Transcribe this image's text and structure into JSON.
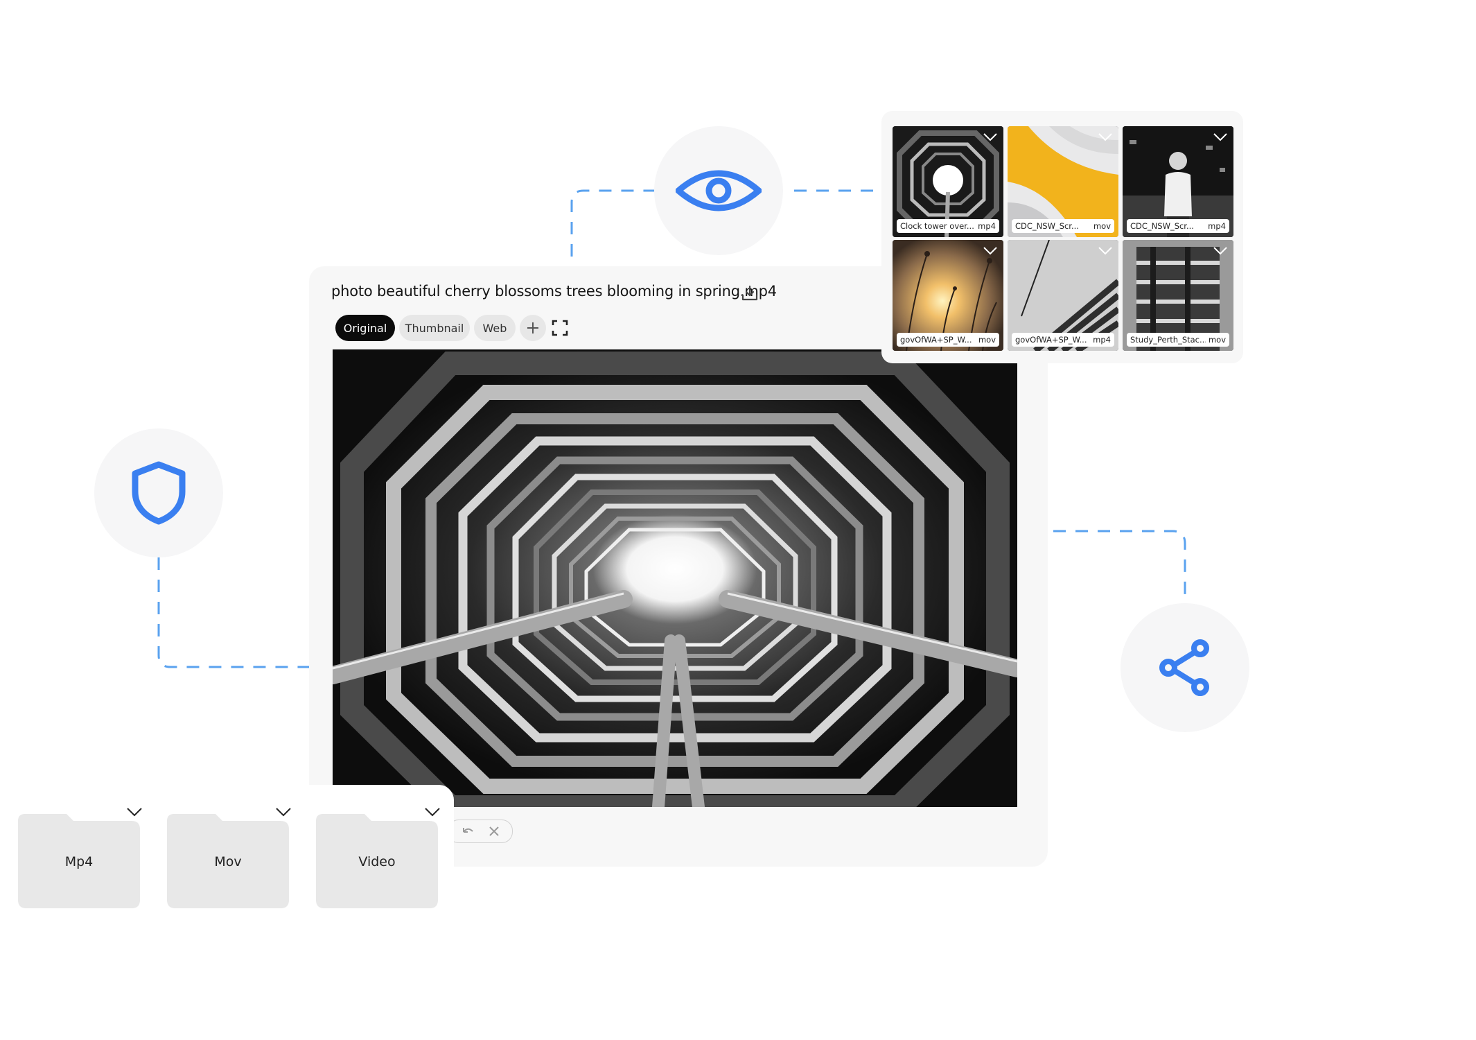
{
  "viewer": {
    "title": "photo beautiful cherry blossoms trees blooming in spring.mp4",
    "tabs": [
      {
        "label": "Original",
        "active": true
      },
      {
        "label": "Thumbnail",
        "active": false
      },
      {
        "label": "Web",
        "active": false
      }
    ],
    "add_button": "+"
  },
  "thumbnails": [
    {
      "name": "Clock tower over...",
      "ext": "mp4"
    },
    {
      "name": "CDC_NSW_Scr...",
      "ext": "mov"
    },
    {
      "name": "CDC_NSW_Scr...",
      "ext": "mp4"
    },
    {
      "name": "govOfWA+SP_W...",
      "ext": "mov"
    },
    {
      "name": "govOfWA+SP_W...",
      "ext": "mp4"
    },
    {
      "name": "Study_Perth_Stac...",
      "ext": "mov"
    }
  ],
  "folders": [
    {
      "label": "Mp4"
    },
    {
      "label": "Mov"
    },
    {
      "label": "Video"
    }
  ],
  "feature_icons": [
    "eye-icon",
    "shield-icon",
    "share-icon"
  ],
  "colors": {
    "accent": "#3a7ff0",
    "connector": "#5aa2ef",
    "panel": "#f7f7f7",
    "active_tab": "#0b0b0b"
  }
}
